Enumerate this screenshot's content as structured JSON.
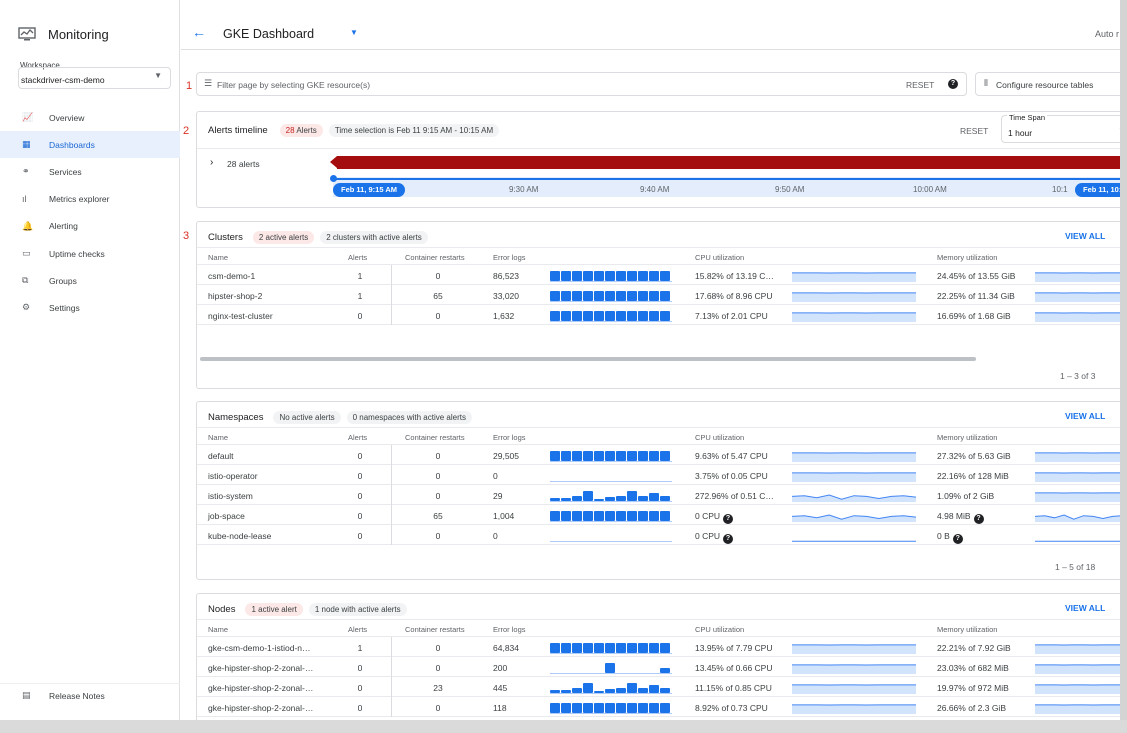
{
  "app": {
    "title": "Monitoring",
    "workspace_label": "Workspace",
    "workspace_value": "stackdriver-csm-demo"
  },
  "nav": [
    {
      "label": "Overview",
      "icon": "chart-icon",
      "glyph": "📈",
      "active": false
    },
    {
      "label": "Dashboards",
      "icon": "dashboard-icon",
      "glyph": "▦",
      "active": true
    },
    {
      "label": "Services",
      "icon": "services-icon",
      "glyph": "⚭",
      "active": false
    },
    {
      "label": "Metrics explorer",
      "icon": "bar-chart-icon",
      "glyph": "ıl",
      "active": false
    },
    {
      "label": "Alerting",
      "icon": "bell-icon",
      "glyph": "🔔",
      "active": false
    },
    {
      "label": "Uptime checks",
      "icon": "monitor-icon",
      "glyph": "▭",
      "active": false
    },
    {
      "label": "Groups",
      "icon": "groups-icon",
      "glyph": "⧉",
      "active": false
    },
    {
      "label": "Settings",
      "icon": "gear-icon",
      "glyph": "⚙",
      "active": false
    }
  ],
  "release_notes": "Release Notes",
  "header": {
    "title": "GKE Dashboard",
    "auto_refresh": "Auto r"
  },
  "markers": [
    "1",
    "2",
    "3"
  ],
  "filter": {
    "placeholder": "Filter page by selecting GKE resource(s)",
    "reset": "RESET",
    "configure": "Configure resource tables"
  },
  "timeline": {
    "title": "Alerts timeline",
    "alert_count": "28",
    "alert_word": "Alerts",
    "selection": "Time selection is Feb 11 9:15 AM - 10:15 AM",
    "reset": "RESET",
    "timespan_label": "Time Span",
    "timespan_value": "1 hour",
    "row_label": "28 alerts",
    "ticks": [
      "9:30 AM",
      "9:40 AM",
      "9:50 AM",
      "10:00 AM",
      "10:1"
    ],
    "start_pill": "Feb 11, 9:15 AM",
    "end_pill": "Feb 11, 10:"
  },
  "columns": {
    "name": "Name",
    "alerts": "Alerts",
    "restarts": "Container restarts",
    "errors": "Error logs",
    "cpu": "CPU utilization",
    "mem": "Memory utilization"
  },
  "clusters": {
    "title": "Clusters",
    "chip1": "2 active alerts",
    "chip2": "2 clusters with active alerts",
    "view_all": "VIEW ALL",
    "pager": "1 – 3 of 3",
    "rows": [
      {
        "name": "csm-demo-1",
        "alerts": "1",
        "restarts": "0",
        "errors": "86,523",
        "err_spark": "full",
        "cpu": "15.82% of 13.19 C…",
        "cpu_spark": "flat",
        "mem": "24.45% of 13.55 GiB",
        "mem_spark": "flat"
      },
      {
        "name": "hipster-shop-2",
        "alerts": "1",
        "restarts": "65",
        "errors": "33,020",
        "err_spark": "full",
        "cpu": "17.68% of 8.96 CPU",
        "cpu_spark": "flat",
        "mem": "22.25% of 11.34 GiB",
        "mem_spark": "flat"
      },
      {
        "name": "nginx-test-cluster",
        "alerts": "0",
        "restarts": "0",
        "errors": "1,632",
        "err_spark": "full",
        "cpu": "7.13% of 2.01 CPU",
        "cpu_spark": "flat",
        "mem": "16.69% of 1.68 GiB",
        "mem_spark": "flat"
      }
    ]
  },
  "namespaces": {
    "title": "Namespaces",
    "chip1": "No active alerts",
    "chip2": "0 namespaces with active alerts",
    "view_all": "VIEW ALL",
    "pager": "1 – 5 of 18",
    "rows": [
      {
        "name": "default",
        "alerts": "0",
        "restarts": "0",
        "errors": "29,505",
        "err_spark": "full",
        "cpu": "9.63% of 5.47 CPU",
        "cpu_spark": "flat",
        "mem": "27.32% of 5.63 GiB",
        "mem_spark": "flat"
      },
      {
        "name": "istio-operator",
        "alerts": "0",
        "restarts": "0",
        "errors": "0",
        "err_spark": "none",
        "cpu": "3.75% of 0.05 CPU",
        "cpu_spark": "flat",
        "mem": "22.16% of 128 MiB",
        "mem_spark": "flat"
      },
      {
        "name": "istio-system",
        "alerts": "0",
        "restarts": "0",
        "errors": "29",
        "err_spark": "partial",
        "cpu": "272.96% of 0.51 C…",
        "cpu_spark": "wave",
        "mem": "1.09% of 2 GiB",
        "mem_spark": "flat"
      },
      {
        "name": "job-space",
        "alerts": "0",
        "restarts": "65",
        "errors": "1,004",
        "err_spark": "full",
        "cpu": "0 CPU",
        "cpu_help": true,
        "cpu_spark": "wave",
        "mem": "4.98 MiB",
        "mem_help": true,
        "mem_spark": "wave"
      },
      {
        "name": "kube-node-lease",
        "alerts": "0",
        "restarts": "0",
        "errors": "0",
        "err_spark": "none",
        "cpu": "0 CPU",
        "cpu_help": true,
        "cpu_spark": "line",
        "mem": "0 B",
        "mem_help": true,
        "mem_spark": "line"
      }
    ]
  },
  "nodes": {
    "title": "Nodes",
    "chip1": "1 active alert",
    "chip2": "1 node with active alerts",
    "view_all": "VIEW ALL",
    "rows": [
      {
        "name": "gke-csm-demo-1-istiod-n…",
        "alerts": "1",
        "restarts": "0",
        "errors": "64,834",
        "err_spark": "full",
        "cpu": "13.95% of 7.79 CPU",
        "cpu_spark": "flat",
        "mem": "22.21% of 7.92 GiB",
        "mem_spark": "flat"
      },
      {
        "name": "gke-hipster-shop-2-zonal-…",
        "alerts": "0",
        "restarts": "0",
        "errors": "200",
        "err_spark": "sparse",
        "cpu": "13.45% of 0.66 CPU",
        "cpu_spark": "flat",
        "mem": "23.03% of 682 MiB",
        "mem_spark": "flat"
      },
      {
        "name": "gke-hipster-shop-2-zonal-…",
        "alerts": "0",
        "restarts": "23",
        "errors": "445",
        "err_spark": "partial",
        "cpu": "11.15% of 0.85 CPU",
        "cpu_spark": "flat",
        "mem": "19.97% of 972 MiB",
        "mem_spark": "flat"
      },
      {
        "name": "gke-hipster-shop-2-zonal-…",
        "alerts": "0",
        "restarts": "0",
        "errors": "118",
        "err_spark": "full",
        "cpu": "8.92% of 0.73 CPU",
        "cpu_spark": "flat",
        "mem": "26.66% of 2.3 GiB",
        "mem_spark": "flat"
      }
    ]
  },
  "colors": {
    "accent": "#1a73e8",
    "alert_red": "#a50e0e",
    "spark_fill": "#aecbfa",
    "bar_blue": "#1a73e8"
  }
}
